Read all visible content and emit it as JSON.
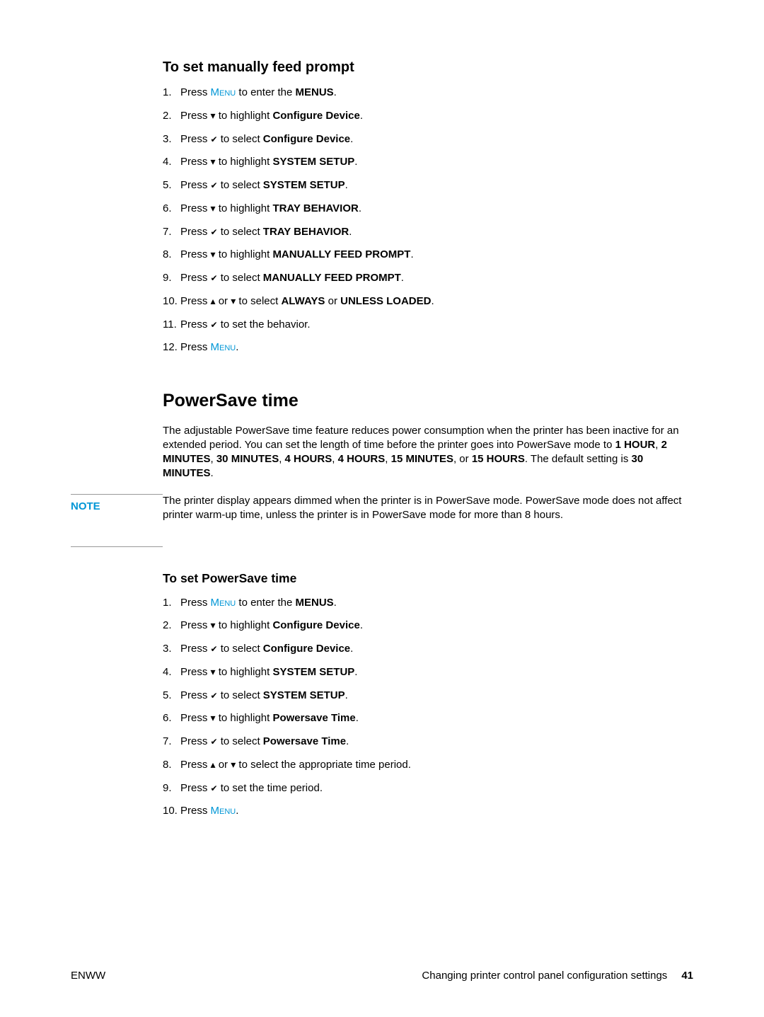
{
  "section1": {
    "heading": "To set manually feed prompt",
    "steps": [
      {
        "num": "1.",
        "pre": "Press ",
        "menu": "Menu",
        "mid": " to enter the ",
        "bold": "MENUS",
        "post": "."
      },
      {
        "num": "2.",
        "pre": "Press ",
        "icon": "down",
        "mid": " to highlight ",
        "bold": "Configure Device",
        "post": "."
      },
      {
        "num": "3.",
        "pre": "Press ",
        "icon": "check",
        "mid": " to select ",
        "bold": "Configure Device",
        "post": "."
      },
      {
        "num": "4.",
        "pre": "Press ",
        "icon": "down",
        "mid": " to highlight ",
        "bold": "SYSTEM SETUP",
        "post": "."
      },
      {
        "num": "5.",
        "pre": "Press ",
        "icon": "check",
        "mid": " to select ",
        "bold": "SYSTEM SETUP",
        "post": "."
      },
      {
        "num": "6.",
        "pre": "Press ",
        "icon": "down",
        "mid": " to highlight ",
        "bold": "TRAY BEHAVIOR",
        "post": "."
      },
      {
        "num": "7.",
        "pre": "Press ",
        "icon": "check",
        "mid": " to select ",
        "bold": "TRAY BEHAVIOR",
        "post": "."
      },
      {
        "num": "8.",
        "pre": "Press ",
        "icon": "down",
        "mid": " to highlight ",
        "bold": "MANUALLY FEED PROMPT",
        "post": "."
      },
      {
        "num": "9.",
        "pre": "Press ",
        "icon": "check",
        "mid": " to select ",
        "bold": "MANUALLY FEED PROMPT",
        "post": "."
      },
      {
        "num": "10.",
        "pre": "Press ",
        "icon": "up",
        "mid1": " or ",
        "icon2": "down",
        "mid": " to select ",
        "bold": "ALWAYS",
        "mid2": " or ",
        "bold2": "UNLESS LOADED",
        "post": "."
      },
      {
        "num": "11.",
        "pre": "Press ",
        "icon": "check",
        "mid": " to set the behavior.",
        "post": ""
      },
      {
        "num": "12.",
        "pre": "Press ",
        "menu": "Menu",
        "post": "."
      }
    ]
  },
  "section2": {
    "heading": "PowerSave time",
    "para1_pre": "The adjustable PowerSave time feature reduces power consumption when the printer has been inactive for an extended period. You can set the length of time before the printer goes into PowerSave mode to ",
    "para1_b1": "1 HOUR",
    "para1_s1": ", ",
    "para1_b2": "2 MINUTES",
    "para1_s2": ", ",
    "para1_b3": "30 MINUTES",
    "para1_s3": ", ",
    "para1_b4": "4 HOURS",
    "para1_s4": ", ",
    "para1_b5": "4 HOURS",
    "para1_s5": ", ",
    "para1_b6": "15 MINUTES",
    "para1_s6": ", or ",
    "para1_b7": "15 HOURS",
    "para1_s7": ". The default setting is ",
    "para1_b8": "30 MINUTES",
    "para1_post": ".",
    "note_label": "NOTE",
    "note_body": "The printer display appears dimmed when the printer is in PowerSave mode. PowerSave mode does not affect printer warm-up time, unless the printer is in PowerSave mode for more than 8 hours."
  },
  "section3": {
    "heading": "To set PowerSave time",
    "steps": [
      {
        "num": "1.",
        "pre": "Press ",
        "menu": "Menu",
        "mid": " to enter the ",
        "bold": "MENUS",
        "post": "."
      },
      {
        "num": "2.",
        "pre": "Press ",
        "icon": "down",
        "mid": " to highlight ",
        "bold": "Configure Device",
        "post": "."
      },
      {
        "num": "3.",
        "pre": "Press ",
        "icon": "check",
        "mid": " to select ",
        "bold": "Configure Device",
        "post": "."
      },
      {
        "num": "4.",
        "pre": "Press ",
        "icon": "down",
        "mid": " to highlight ",
        "bold": "SYSTEM SETUP",
        "post": "."
      },
      {
        "num": "5.",
        "pre": "Press ",
        "icon": "check",
        "mid": " to select ",
        "bold": "SYSTEM SETUP",
        "post": "."
      },
      {
        "num": "6.",
        "pre": "Press ",
        "icon": "down",
        "mid": " to highlight ",
        "bold": "Powersave Time",
        "post": "."
      },
      {
        "num": "7.",
        "pre": "Press ",
        "icon": "check",
        "mid": " to select ",
        "bold": "Powersave Time",
        "post": "."
      },
      {
        "num": "8.",
        "pre": "Press ",
        "icon": "up",
        "mid1": " or ",
        "icon2": "down",
        "mid": " to select the appropriate time period.",
        "post": ""
      },
      {
        "num": "9.",
        "pre": "Press ",
        "icon": "check",
        "mid": " to set the time period.",
        "post": ""
      },
      {
        "num": "10.",
        "pre": "Press ",
        "menu": "Menu",
        "post": "."
      }
    ]
  },
  "footer": {
    "left": "ENWW",
    "right_text": "Changing printer control panel configuration settings",
    "pagenum": "41"
  }
}
